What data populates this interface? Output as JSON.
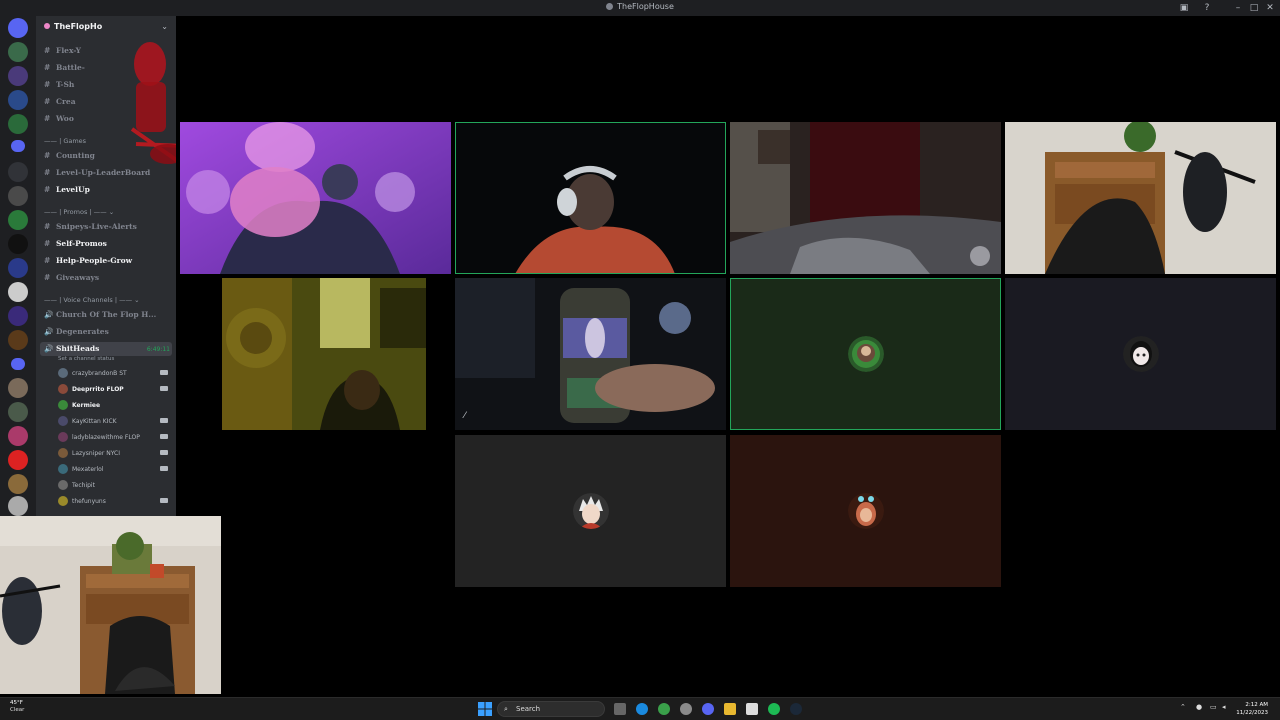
{
  "window": {
    "title": "TheFlopHouse"
  },
  "server": {
    "name": "TheFlopHo"
  },
  "channels": [
    {
      "name": "Flex-Y",
      "icon": "#",
      "bright": false
    },
    {
      "name": "Battle-",
      "icon": "#",
      "bright": false
    },
    {
      "name": "T-Sh",
      "icon": "#",
      "bright": false
    },
    {
      "name": "Crea",
      "icon": "#",
      "bright": false
    },
    {
      "name": "Woo",
      "icon": "#",
      "bright": false
    }
  ],
  "category_games": "Games",
  "counting_channel": "Counting",
  "leaderboard_channel": "Level-Up-LeaderBoard",
  "levelup_channel": "LevelUp",
  "category_promos": "Promos",
  "promo_channels": [
    {
      "name": "Snipeys-Live-Alerts",
      "bright": false
    },
    {
      "name": "Self-Promos",
      "bright": true
    },
    {
      "name": "Help-People-Grow",
      "bright": true
    },
    {
      "name": "Giveaways",
      "bright": false
    }
  ],
  "category_voice": "Voice Channels",
  "voice_channels": [
    {
      "name": "Church Of The Flop H..."
    },
    {
      "name": "Degenerates"
    }
  ],
  "active_voice": {
    "name": "ShitHeads",
    "timer": "6:49:11",
    "status_hint": "Set a channel status"
  },
  "voice_users": [
    {
      "name": "crazybrandonB",
      "tag": "ST",
      "bright": false,
      "color": "#5a6a7a"
    },
    {
      "name": "Deeprrito",
      "tag": "FLOP",
      "bright": true,
      "color": "#8a4a3a"
    },
    {
      "name": "Kermiee",
      "tag": "",
      "bright": true,
      "color": "#3a8a3a"
    },
    {
      "name": "KayKittan",
      "tag": "KICK",
      "bright": false,
      "color": "#4a4a6a"
    },
    {
      "name": "ladyblazewithme",
      "tag": "FLOP",
      "bright": false,
      "color": "#6a3a5a"
    },
    {
      "name": "Lazysniper",
      "tag": "NYCI",
      "bright": false,
      "color": "#7a5a3a"
    },
    {
      "name": "Mexaterlol",
      "tag": "",
      "bright": false,
      "color": "#3a6a7a"
    },
    {
      "name": "Techipit",
      "tag": "",
      "bright": false,
      "color": "#6a6a6a"
    },
    {
      "name": "thefunyuns",
      "tag": "",
      "bright": false,
      "color": "#9a8a2a"
    }
  ],
  "taskbar": {
    "weather_temp": "45°F",
    "weather_desc": "Clear",
    "search_label": "Search",
    "time": "2:12 AM",
    "date": "11/22/2023"
  },
  "colors": {
    "speaking": "#23a55a",
    "sidebar": "#2b2d31",
    "rail": "#1e1f22"
  }
}
